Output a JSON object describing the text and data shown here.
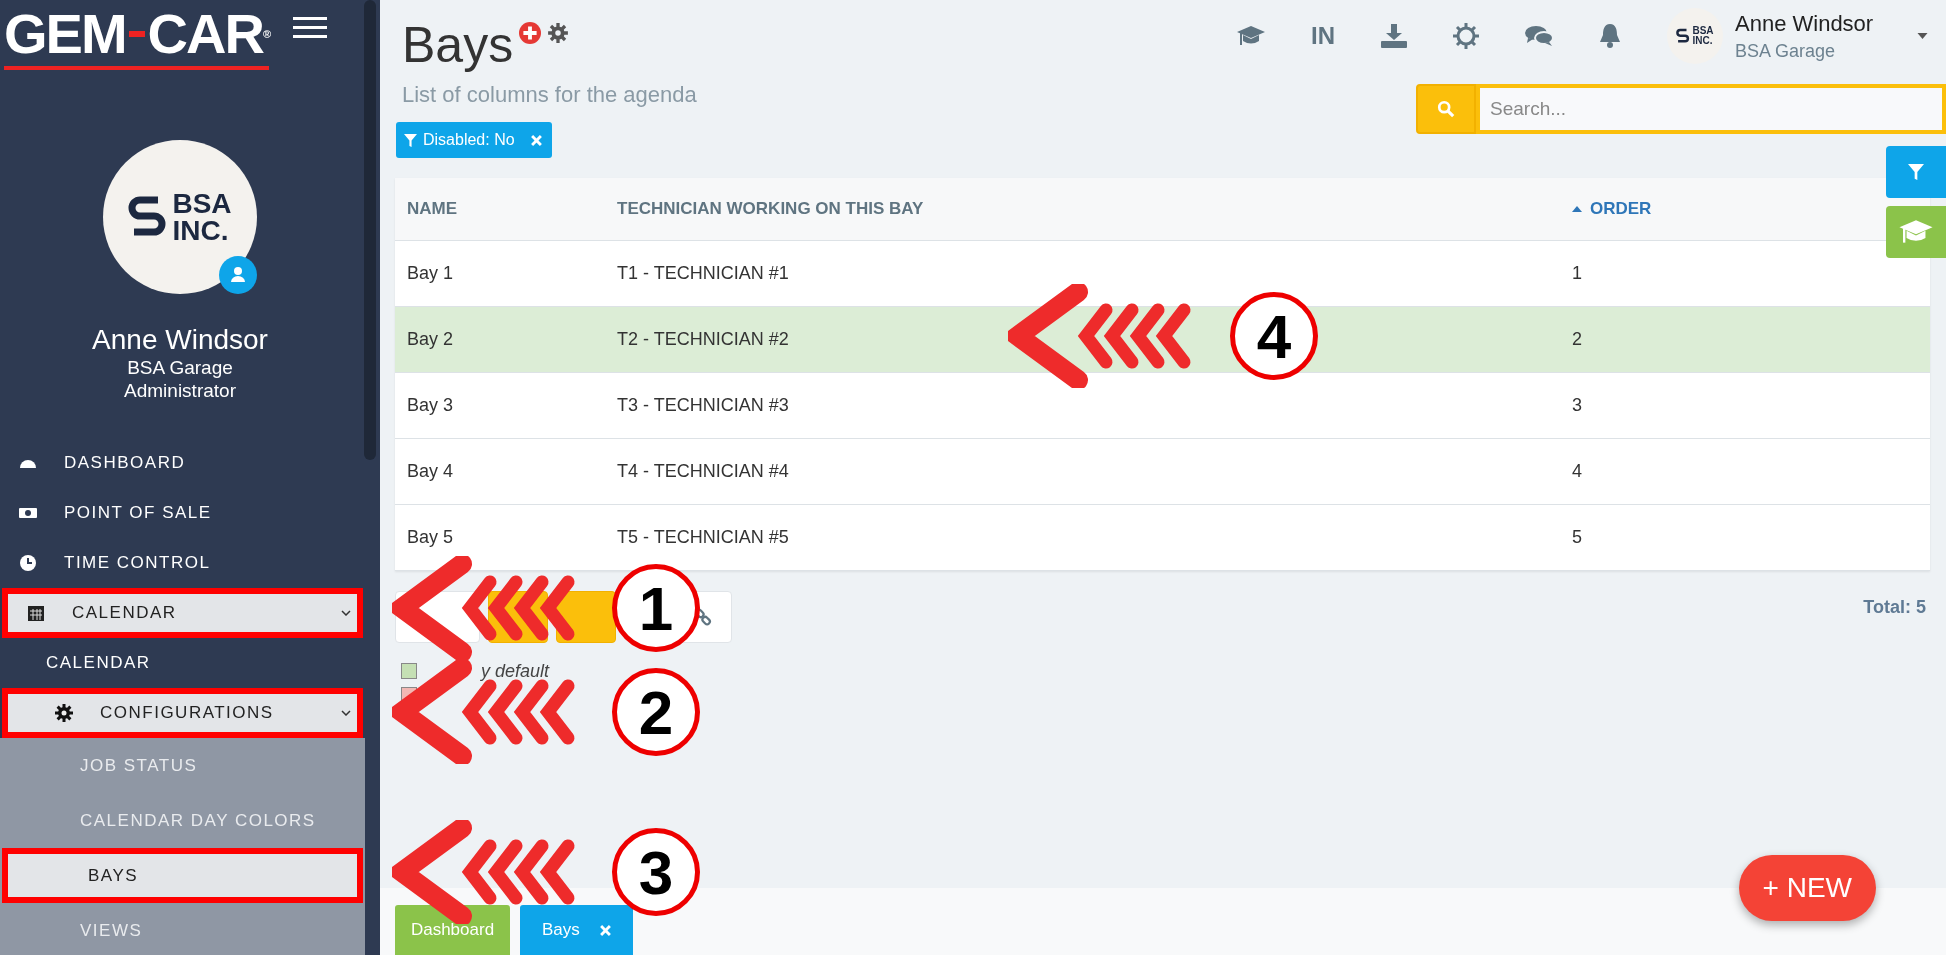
{
  "sidebar": {
    "logo": {
      "left": "GEM",
      "right": "CAR",
      "mark": "®"
    },
    "profile": {
      "logo_lines": [
        "BSA",
        "INC."
      ],
      "name": "Anne Windsor",
      "company": "BSA Garage",
      "role": "Administrator"
    },
    "menu": [
      {
        "label": "DASHBOARD",
        "selected": false,
        "outlined": false
      },
      {
        "label": "POINT OF SALE",
        "selected": false,
        "outlined": false
      },
      {
        "label": "TIME CONTROL",
        "selected": false,
        "outlined": false
      },
      {
        "label": "CALENDAR",
        "outlined": true,
        "expanded": true,
        "children": [
          {
            "label": "CALENDAR",
            "selected": false,
            "outlined": false
          },
          {
            "label": "CONFIGURATIONS",
            "outlined": true,
            "expanded": true,
            "children": [
              {
                "label": "JOB STATUS",
                "selected": false,
                "outlined": false
              },
              {
                "label": "CALENDAR DAY COLORS",
                "selected": false,
                "outlined": false
              },
              {
                "label": "BAYS",
                "selected": true,
                "outlined": true
              },
              {
                "label": "VIEWS",
                "selected": false,
                "outlined": false
              }
            ]
          }
        ]
      }
    ]
  },
  "header": {
    "title": "Bays",
    "subtitle": "List of columns for the agenda",
    "filter_chip": "Disabled: No",
    "toolbar_icons": [
      {
        "kind": "cap"
      },
      {
        "kind": "text",
        "label": "IN"
      },
      {
        "kind": "download"
      },
      {
        "kind": "sun"
      },
      {
        "kind": "chat"
      },
      {
        "kind": "bell"
      }
    ],
    "user": {
      "logo_lines": [
        "BSA",
        "INC."
      ],
      "name": "Anne Windsor",
      "company": "BSA Garage"
    },
    "search": {
      "placeholder": "Search..."
    }
  },
  "table": {
    "columns": [
      {
        "label": "NAME",
        "sorted": false
      },
      {
        "label": "TECHNICIAN WORKING ON THIS BAY",
        "sorted": false
      },
      {
        "label": "ORDER",
        "sorted": true
      }
    ],
    "rows": [
      {
        "cells": [
          "Bay 1",
          "T1 - TECHNICIAN #1",
          "1"
        ],
        "default": false
      },
      {
        "cells": [
          "Bay 2",
          "T2 - TECHNICIAN #2",
          "2"
        ],
        "default": true
      },
      {
        "cells": [
          "Bay 3",
          "T3 - TECHNICIAN #3",
          "3"
        ],
        "default": false
      },
      {
        "cells": [
          "Bay 4",
          "T4 - TECHNICIAN #4",
          "4"
        ],
        "default": false
      },
      {
        "cells": [
          "Bay 5",
          "T5 - TECHNICIAN #5",
          "5"
        ],
        "default": false
      }
    ],
    "total": "Total: 5"
  },
  "toolbar": [
    {
      "kind": "plain"
    },
    {
      "kind": "warning"
    },
    {
      "kind": "excel"
    },
    {
      "kind": "link"
    }
  ],
  "legend": [
    {
      "color": "#c5e0b4",
      "text": "y default"
    },
    {
      "color": "#f2b8b4"
    }
  ],
  "bottom_tabs": [
    {
      "label": "Dashboard",
      "selected": false,
      "closable": false
    },
    {
      "label": "Bays",
      "selected": true,
      "closable": true
    }
  ],
  "new_button": "+ NEW",
  "annotations": [
    {
      "number": "1"
    },
    {
      "number": "2"
    },
    {
      "number": "3"
    },
    {
      "number": "4"
    }
  ]
}
